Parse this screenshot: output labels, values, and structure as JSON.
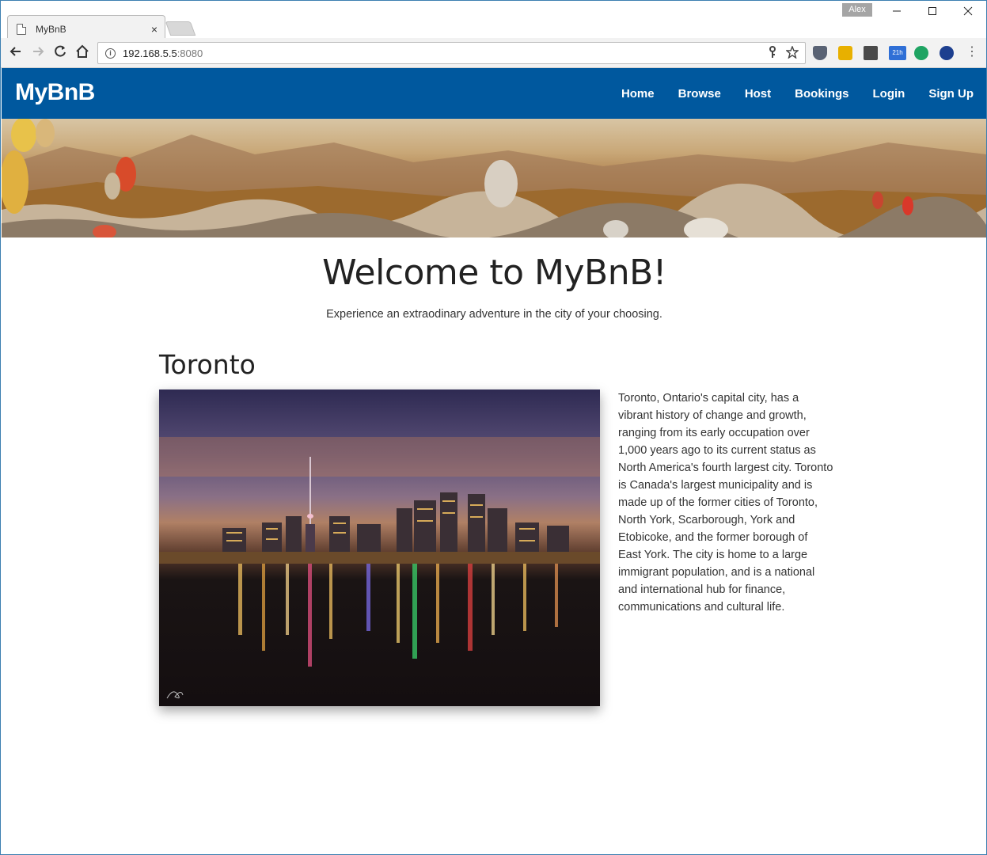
{
  "browser": {
    "tab_title": "MyBnB",
    "tab_close": "×",
    "profile_name": "Alex",
    "url_host": "192.168.5.5",
    "url_port": ":8080",
    "window_controls": [
      "–",
      "☐",
      "✕"
    ],
    "nav_back": "←",
    "nav_forward": "→",
    "nav_reload": "↻",
    "nav_home": "⌂",
    "menu": "⋮",
    "extension_badge": "21h"
  },
  "site": {
    "brand": "MyBnB",
    "nav": [
      "Home",
      "Browse",
      "Host",
      "Bookings",
      "Login",
      "Sign Up"
    ],
    "accent_color": "#00589e"
  },
  "main": {
    "heading": "Welcome to MyBnB!",
    "tagline": "Experience an extraodinary adventure in the city of your choosing.",
    "city": {
      "name": "Toronto",
      "description": "Toronto, Ontario's capital city, has a vibrant history of change and growth, ranging from its early occupation over 1,000 years ago to its current status as North America's fourth largest city. Toronto is Canada's largest municipality and is made up of the former cities of Toronto, North York, Scarborough, York and Etobicoke, and the former borough of East York. The city is home to a large immigrant population, and is a national and international hub for finance, communications and cultural life."
    }
  }
}
